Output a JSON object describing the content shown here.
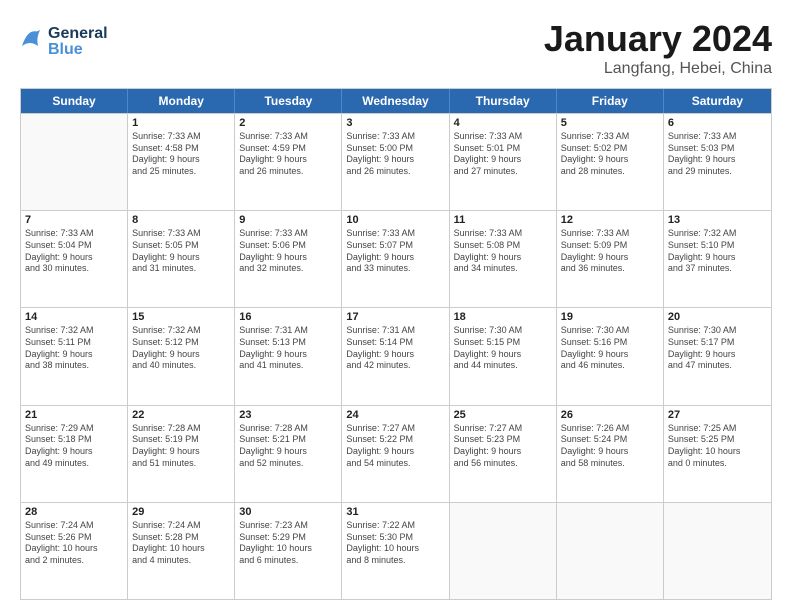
{
  "header": {
    "logo_general": "General",
    "logo_blue": "Blue",
    "month_title": "January 2024",
    "location": "Langfang, Hebei, China"
  },
  "weekdays": [
    "Sunday",
    "Monday",
    "Tuesday",
    "Wednesday",
    "Thursday",
    "Friday",
    "Saturday"
  ],
  "weeks": [
    [
      {
        "day": "",
        "lines": []
      },
      {
        "day": "1",
        "lines": [
          "Sunrise: 7:33 AM",
          "Sunset: 4:58 PM",
          "Daylight: 9 hours",
          "and 25 minutes."
        ]
      },
      {
        "day": "2",
        "lines": [
          "Sunrise: 7:33 AM",
          "Sunset: 4:59 PM",
          "Daylight: 9 hours",
          "and 26 minutes."
        ]
      },
      {
        "day": "3",
        "lines": [
          "Sunrise: 7:33 AM",
          "Sunset: 5:00 PM",
          "Daylight: 9 hours",
          "and 26 minutes."
        ]
      },
      {
        "day": "4",
        "lines": [
          "Sunrise: 7:33 AM",
          "Sunset: 5:01 PM",
          "Daylight: 9 hours",
          "and 27 minutes."
        ]
      },
      {
        "day": "5",
        "lines": [
          "Sunrise: 7:33 AM",
          "Sunset: 5:02 PM",
          "Daylight: 9 hours",
          "and 28 minutes."
        ]
      },
      {
        "day": "6",
        "lines": [
          "Sunrise: 7:33 AM",
          "Sunset: 5:03 PM",
          "Daylight: 9 hours",
          "and 29 minutes."
        ]
      }
    ],
    [
      {
        "day": "7",
        "lines": [
          "Sunrise: 7:33 AM",
          "Sunset: 5:04 PM",
          "Daylight: 9 hours",
          "and 30 minutes."
        ]
      },
      {
        "day": "8",
        "lines": [
          "Sunrise: 7:33 AM",
          "Sunset: 5:05 PM",
          "Daylight: 9 hours",
          "and 31 minutes."
        ]
      },
      {
        "day": "9",
        "lines": [
          "Sunrise: 7:33 AM",
          "Sunset: 5:06 PM",
          "Daylight: 9 hours",
          "and 32 minutes."
        ]
      },
      {
        "day": "10",
        "lines": [
          "Sunrise: 7:33 AM",
          "Sunset: 5:07 PM",
          "Daylight: 9 hours",
          "and 33 minutes."
        ]
      },
      {
        "day": "11",
        "lines": [
          "Sunrise: 7:33 AM",
          "Sunset: 5:08 PM",
          "Daylight: 9 hours",
          "and 34 minutes."
        ]
      },
      {
        "day": "12",
        "lines": [
          "Sunrise: 7:33 AM",
          "Sunset: 5:09 PM",
          "Daylight: 9 hours",
          "and 36 minutes."
        ]
      },
      {
        "day": "13",
        "lines": [
          "Sunrise: 7:32 AM",
          "Sunset: 5:10 PM",
          "Daylight: 9 hours",
          "and 37 minutes."
        ]
      }
    ],
    [
      {
        "day": "14",
        "lines": [
          "Sunrise: 7:32 AM",
          "Sunset: 5:11 PM",
          "Daylight: 9 hours",
          "and 38 minutes."
        ]
      },
      {
        "day": "15",
        "lines": [
          "Sunrise: 7:32 AM",
          "Sunset: 5:12 PM",
          "Daylight: 9 hours",
          "and 40 minutes."
        ]
      },
      {
        "day": "16",
        "lines": [
          "Sunrise: 7:31 AM",
          "Sunset: 5:13 PM",
          "Daylight: 9 hours",
          "and 41 minutes."
        ]
      },
      {
        "day": "17",
        "lines": [
          "Sunrise: 7:31 AM",
          "Sunset: 5:14 PM",
          "Daylight: 9 hours",
          "and 42 minutes."
        ]
      },
      {
        "day": "18",
        "lines": [
          "Sunrise: 7:30 AM",
          "Sunset: 5:15 PM",
          "Daylight: 9 hours",
          "and 44 minutes."
        ]
      },
      {
        "day": "19",
        "lines": [
          "Sunrise: 7:30 AM",
          "Sunset: 5:16 PM",
          "Daylight: 9 hours",
          "and 46 minutes."
        ]
      },
      {
        "day": "20",
        "lines": [
          "Sunrise: 7:30 AM",
          "Sunset: 5:17 PM",
          "Daylight: 9 hours",
          "and 47 minutes."
        ]
      }
    ],
    [
      {
        "day": "21",
        "lines": [
          "Sunrise: 7:29 AM",
          "Sunset: 5:18 PM",
          "Daylight: 9 hours",
          "and 49 minutes."
        ]
      },
      {
        "day": "22",
        "lines": [
          "Sunrise: 7:28 AM",
          "Sunset: 5:19 PM",
          "Daylight: 9 hours",
          "and 51 minutes."
        ]
      },
      {
        "day": "23",
        "lines": [
          "Sunrise: 7:28 AM",
          "Sunset: 5:21 PM",
          "Daylight: 9 hours",
          "and 52 minutes."
        ]
      },
      {
        "day": "24",
        "lines": [
          "Sunrise: 7:27 AM",
          "Sunset: 5:22 PM",
          "Daylight: 9 hours",
          "and 54 minutes."
        ]
      },
      {
        "day": "25",
        "lines": [
          "Sunrise: 7:27 AM",
          "Sunset: 5:23 PM",
          "Daylight: 9 hours",
          "and 56 minutes."
        ]
      },
      {
        "day": "26",
        "lines": [
          "Sunrise: 7:26 AM",
          "Sunset: 5:24 PM",
          "Daylight: 9 hours",
          "and 58 minutes."
        ]
      },
      {
        "day": "27",
        "lines": [
          "Sunrise: 7:25 AM",
          "Sunset: 5:25 PM",
          "Daylight: 10 hours",
          "and 0 minutes."
        ]
      }
    ],
    [
      {
        "day": "28",
        "lines": [
          "Sunrise: 7:24 AM",
          "Sunset: 5:26 PM",
          "Daylight: 10 hours",
          "and 2 minutes."
        ]
      },
      {
        "day": "29",
        "lines": [
          "Sunrise: 7:24 AM",
          "Sunset: 5:28 PM",
          "Daylight: 10 hours",
          "and 4 minutes."
        ]
      },
      {
        "day": "30",
        "lines": [
          "Sunrise: 7:23 AM",
          "Sunset: 5:29 PM",
          "Daylight: 10 hours",
          "and 6 minutes."
        ]
      },
      {
        "day": "31",
        "lines": [
          "Sunrise: 7:22 AM",
          "Sunset: 5:30 PM",
          "Daylight: 10 hours",
          "and 8 minutes."
        ]
      },
      {
        "day": "",
        "lines": []
      },
      {
        "day": "",
        "lines": []
      },
      {
        "day": "",
        "lines": []
      }
    ]
  ]
}
